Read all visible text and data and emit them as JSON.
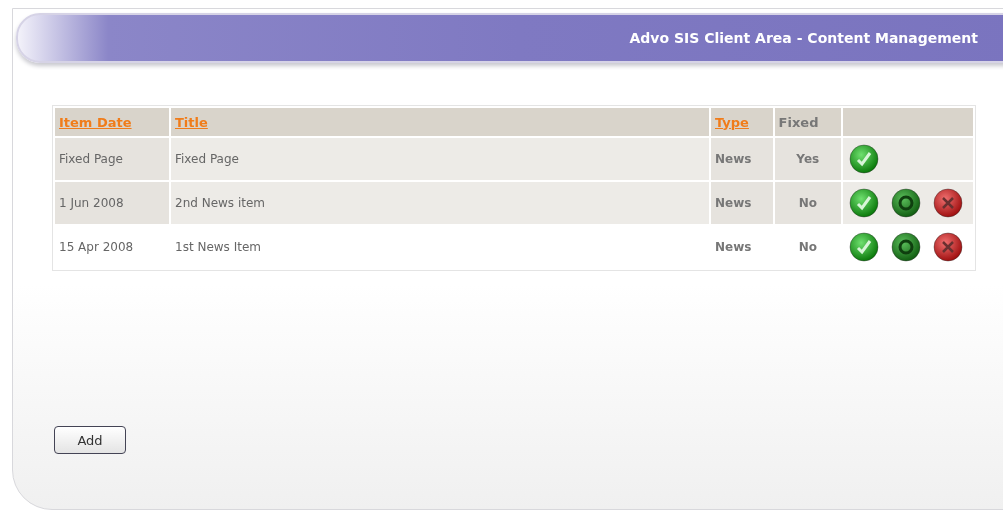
{
  "header": {
    "title": "Advo SIS Client Area - Content Management"
  },
  "table": {
    "columns": [
      {
        "label": "Item Date",
        "sortable": true
      },
      {
        "label": "Title",
        "sortable": true
      },
      {
        "label": "Type",
        "sortable": true
      },
      {
        "label": "Fixed",
        "sortable": false
      }
    ],
    "rows": [
      {
        "date": "Fixed Page",
        "title": "Fixed Page",
        "type": "News",
        "fixed": "Yes",
        "shaded": true,
        "actions": [
          {
            "kind": "approve"
          }
        ]
      },
      {
        "date": "1 Jun 2008",
        "title": "2nd News item",
        "type": "News",
        "fixed": "No",
        "shaded": true,
        "actions": [
          {
            "kind": "approve"
          },
          {
            "kind": "refresh"
          },
          {
            "kind": "delete"
          }
        ]
      },
      {
        "date": "15 Apr 2008",
        "title": "1st News Item",
        "type": "News",
        "fixed": "No",
        "shaded": false,
        "actions": [
          {
            "kind": "approve"
          },
          {
            "kind": "refresh"
          },
          {
            "kind": "delete"
          }
        ]
      }
    ]
  },
  "add_button": "Add"
}
